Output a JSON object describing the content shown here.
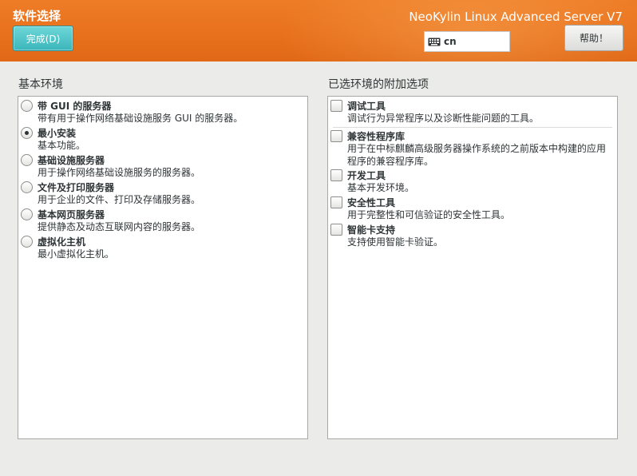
{
  "header": {
    "page_title": "软件选择",
    "done_button": "完成(D)",
    "product_name": "NeoKylin Linux Advanced Server V7",
    "keyboard_layout": "cn",
    "help_button": "帮助！",
    "accent_color": "#e8711d"
  },
  "base_environment": {
    "title": "基本环境",
    "items": [
      {
        "name": "带 GUI 的服务器",
        "desc": "带有用于操作网络基础设施服务 GUI 的服务器。",
        "selected": false
      },
      {
        "name": "最小安装",
        "desc": "基本功能。",
        "selected": true
      },
      {
        "name": "基础设施服务器",
        "desc": "用于操作网络基础设施服务的服务器。",
        "selected": false
      },
      {
        "name": "文件及打印服务器",
        "desc": "用于企业的文件、打印及存储服务器。",
        "selected": false
      },
      {
        "name": "基本网页服务器",
        "desc": "提供静态及动态互联网内容的服务器。",
        "selected": false
      },
      {
        "name": "虚拟化主机",
        "desc": "最小虚拟化主机。",
        "selected": false
      }
    ]
  },
  "addons": {
    "title": "已选环境的附加选项",
    "items": [
      {
        "name": "调试工具",
        "desc": "调试行为异常程序以及诊断性能问题的工具。",
        "checked": false
      },
      {
        "name": "兼容性程序库",
        "desc": "用于在中标麒麟高级服务器操作系统的之前版本中构建的应用程序的兼容程序库。",
        "checked": false
      },
      {
        "name": "开发工具",
        "desc": "基本开发环境。",
        "checked": false
      },
      {
        "name": "安全性工具",
        "desc": "用于完整性和可信验证的安全性工具。",
        "checked": false
      },
      {
        "name": "智能卡支持",
        "desc": "支持使用智能卡验证。",
        "checked": false
      }
    ]
  }
}
